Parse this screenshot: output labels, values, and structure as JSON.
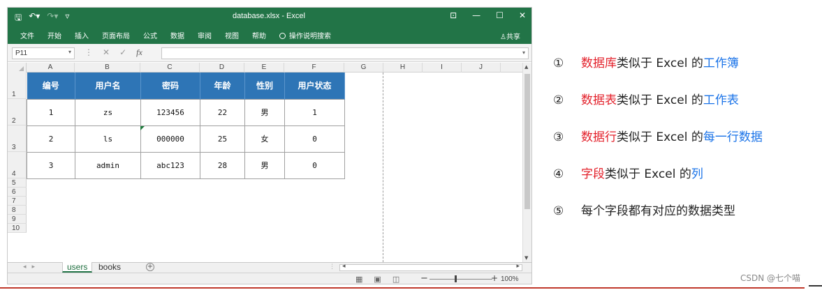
{
  "window": {
    "title": "database.xlsx - Excel",
    "win_buttons": [
      "⊡",
      "—",
      "☐",
      "✕"
    ]
  },
  "ribbon": {
    "tabs": [
      "文件",
      "开始",
      "插入",
      "页面布局",
      "公式",
      "数据",
      "审阅",
      "视图",
      "帮助"
    ],
    "search_label": "操作说明搜索",
    "share_label": "共享"
  },
  "formula_bar": {
    "name_box": "P11",
    "fx_label": "fx",
    "value": ""
  },
  "columns": [
    "A",
    "B",
    "C",
    "D",
    "E",
    "F",
    "G",
    "H",
    "I",
    "J"
  ],
  "rows": [
    "1",
    "2",
    "3",
    "4",
    "5",
    "6",
    "7",
    "8",
    "9",
    "10"
  ],
  "table": {
    "headers": [
      "编号",
      "用户名",
      "密码",
      "年龄",
      "性别",
      "用户状态"
    ],
    "rows": [
      [
        "1",
        "zs",
        "123456",
        "22",
        "男",
        "1"
      ],
      [
        "2",
        "ls",
        "000000",
        "25",
        "女",
        "0"
      ],
      [
        "3",
        "admin",
        "abc123",
        "28",
        "男",
        "0"
      ]
    ]
  },
  "sheet_tabs": [
    "users",
    "books"
  ],
  "status": {
    "zoom": "100%"
  },
  "notes": [
    {
      "num": "①",
      "red": "数据库",
      "mid": "类似于 Excel 的",
      "blue": "工作簿"
    },
    {
      "num": "②",
      "red": "数据表",
      "mid": "类似于 Excel 的",
      "blue": "工作表"
    },
    {
      "num": "③",
      "red": "数据行",
      "mid": "类似于 Excel 的",
      "blue": "每一行数据"
    },
    {
      "num": "④",
      "red": "字段",
      "mid": "类似于 Excel 的",
      "blue": "列"
    },
    {
      "num": "⑤",
      "red": "",
      "mid": "每个字段都有对应的数据类型",
      "blue": ""
    }
  ],
  "footer": "CSDN @七个喵",
  "colors": {
    "excel_green": "#227447",
    "header_blue": "#2e75b6",
    "note_red": "#e3212b",
    "note_blue": "#1a73e8"
  }
}
